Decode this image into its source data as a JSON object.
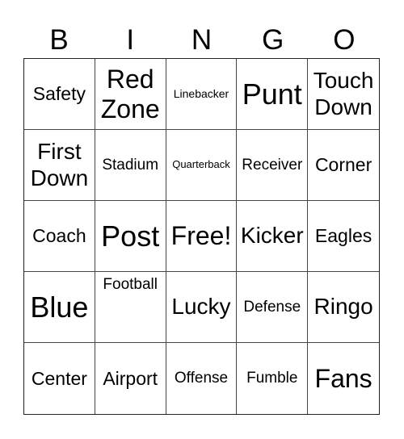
{
  "header": {
    "letters": [
      "B",
      "I",
      "N",
      "G",
      "O"
    ]
  },
  "card": {
    "rows": [
      [
        {
          "text": "Safety",
          "size": "m"
        },
        {
          "text": "Red Zone",
          "size": "xl"
        },
        {
          "text": "Linebacker",
          "size": "xs"
        },
        {
          "text": "Punt",
          "size": "xxl"
        },
        {
          "text": "Touch Down",
          "size": "l"
        }
      ],
      [
        {
          "text": "First Down",
          "size": "l"
        },
        {
          "text": "Stadium",
          "size": "s"
        },
        {
          "text": "Quarterback",
          "size": "xxs"
        },
        {
          "text": "Receiver",
          "size": "s"
        },
        {
          "text": "Corner",
          "size": "m"
        }
      ],
      [
        {
          "text": "Coach",
          "size": "m"
        },
        {
          "text": "Post",
          "size": "xxl"
        },
        {
          "text": "Free!",
          "size": "xl"
        },
        {
          "text": "Kicker",
          "size": "l"
        },
        {
          "text": "Eagles",
          "size": "m"
        }
      ],
      [
        {
          "text": "Blue",
          "size": "xxl"
        },
        {
          "text": "Football",
          "size": "s",
          "align": "top"
        },
        {
          "text": "Lucky",
          "size": "l"
        },
        {
          "text": "Defense",
          "size": "s"
        },
        {
          "text": "Ringo",
          "size": "l"
        }
      ],
      [
        {
          "text": "Center",
          "size": "m"
        },
        {
          "text": "Airport",
          "size": "m"
        },
        {
          "text": "Offense",
          "size": "s"
        },
        {
          "text": "Fumble",
          "size": "s"
        },
        {
          "text": "Fans",
          "size": "xl"
        }
      ]
    ]
  }
}
